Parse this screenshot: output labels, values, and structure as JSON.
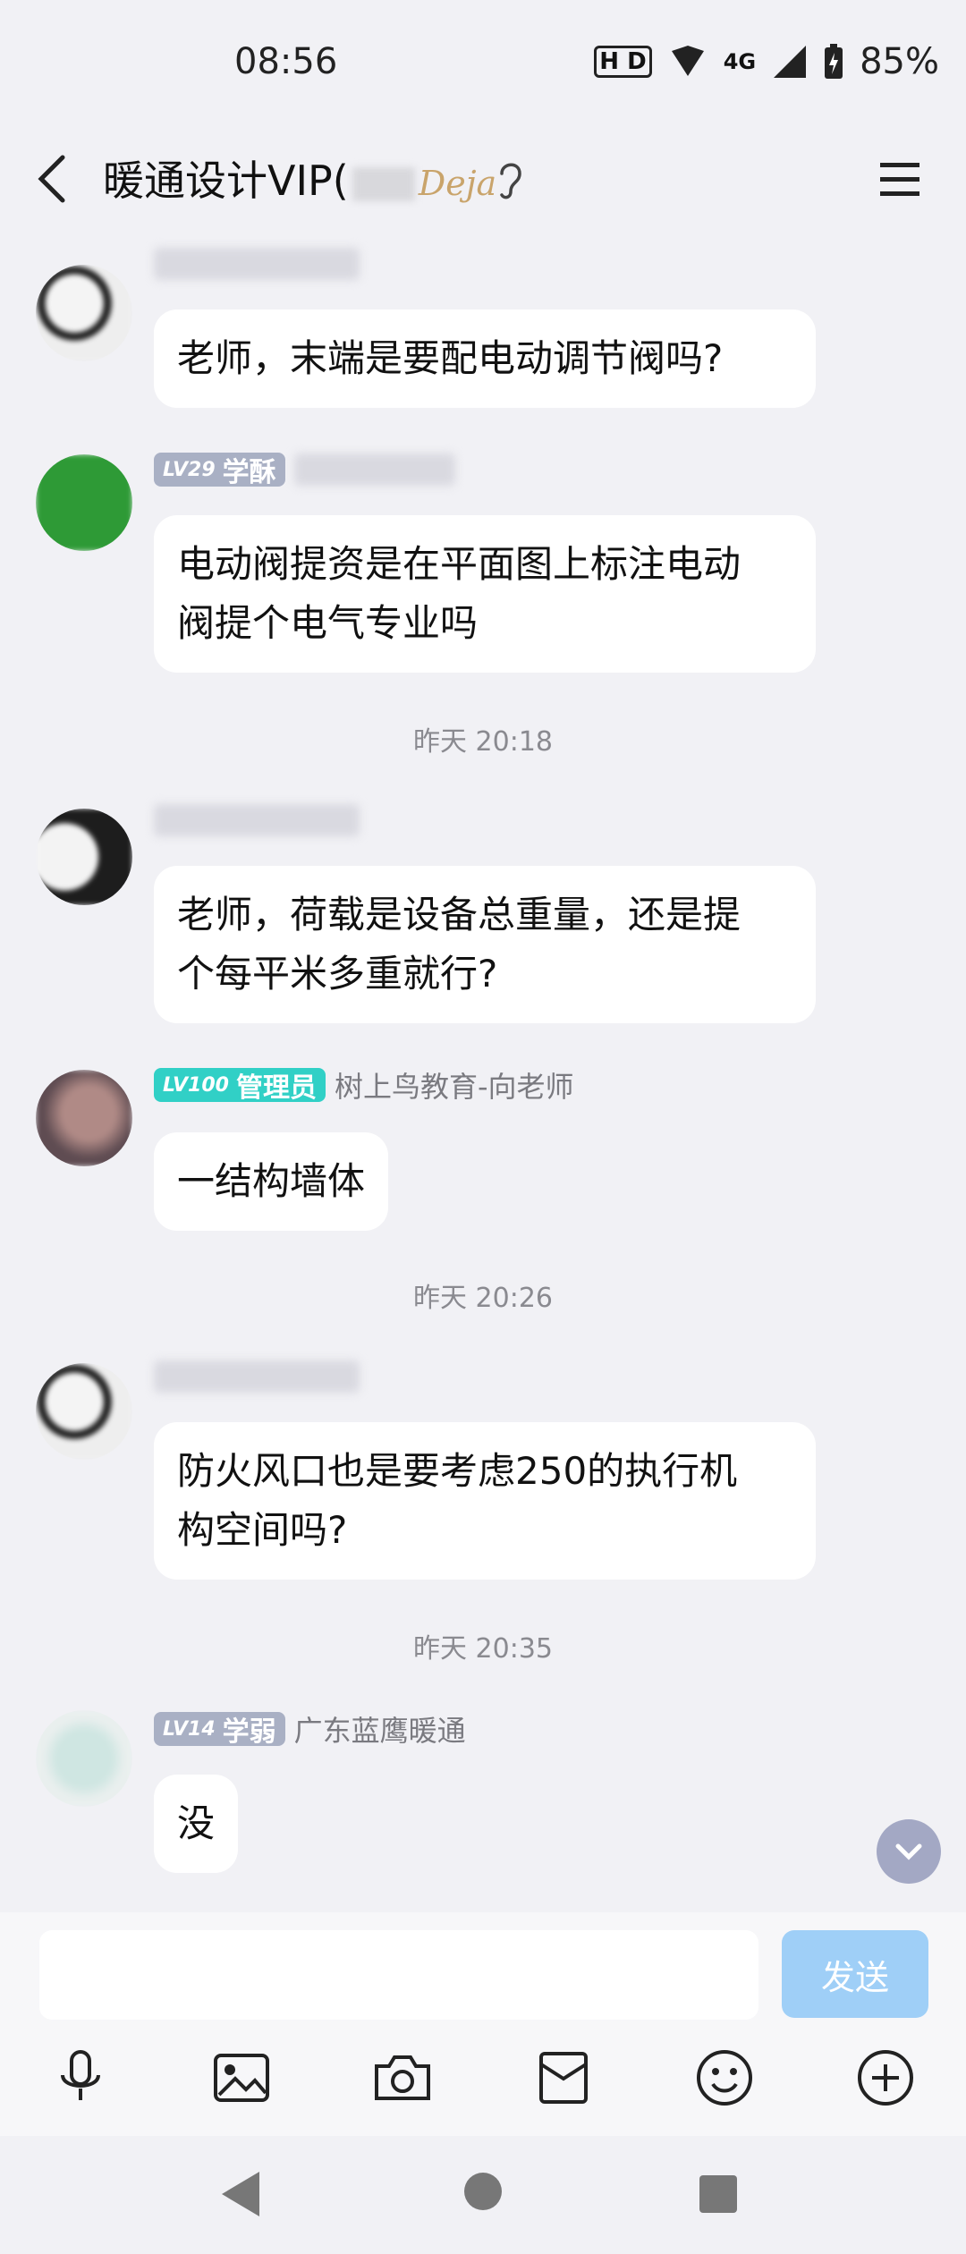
{
  "status": {
    "time": "08:56",
    "network": "4G",
    "battery": "85%"
  },
  "header": {
    "title": "暖通设计VIP(",
    "title_suffix": "Deja"
  },
  "messages": [
    {
      "text": "老师，末端是要配电动调节阀吗?"
    },
    {
      "badge_level": "LV29",
      "badge_role": "学酥",
      "text_line1": "电动阀提资是在平面图上标注电动",
      "text_line2": "阀提个电气专业吗"
    },
    {
      "time": "昨天 20:18"
    },
    {
      "text_line1": "老师，荷载是设备总重量，还是提",
      "text_line2": "个每平米多重就行?"
    },
    {
      "badge_level": "LV100",
      "badge_role": "管理员",
      "nickname": "树上鸟教育-向老师",
      "text": "一结构墙体"
    },
    {
      "time": "昨天 20:26"
    },
    {
      "text_line1": " 防火风口也是要考虑250的执行机",
      "text_line2": "构空间吗?"
    },
    {
      "time": "昨天 20:35"
    },
    {
      "badge_level": "LV14",
      "badge_role": "学弱",
      "nickname": "广东蓝鹰暖通",
      "text": "没"
    }
  ],
  "input": {
    "placeholder": "",
    "send_label": "发送"
  },
  "colors": {
    "background": "#f1f1f5",
    "admin_badge": "#31d0c6",
    "member_badge": "#a9b0c4",
    "send_button": "#9fcff7"
  }
}
